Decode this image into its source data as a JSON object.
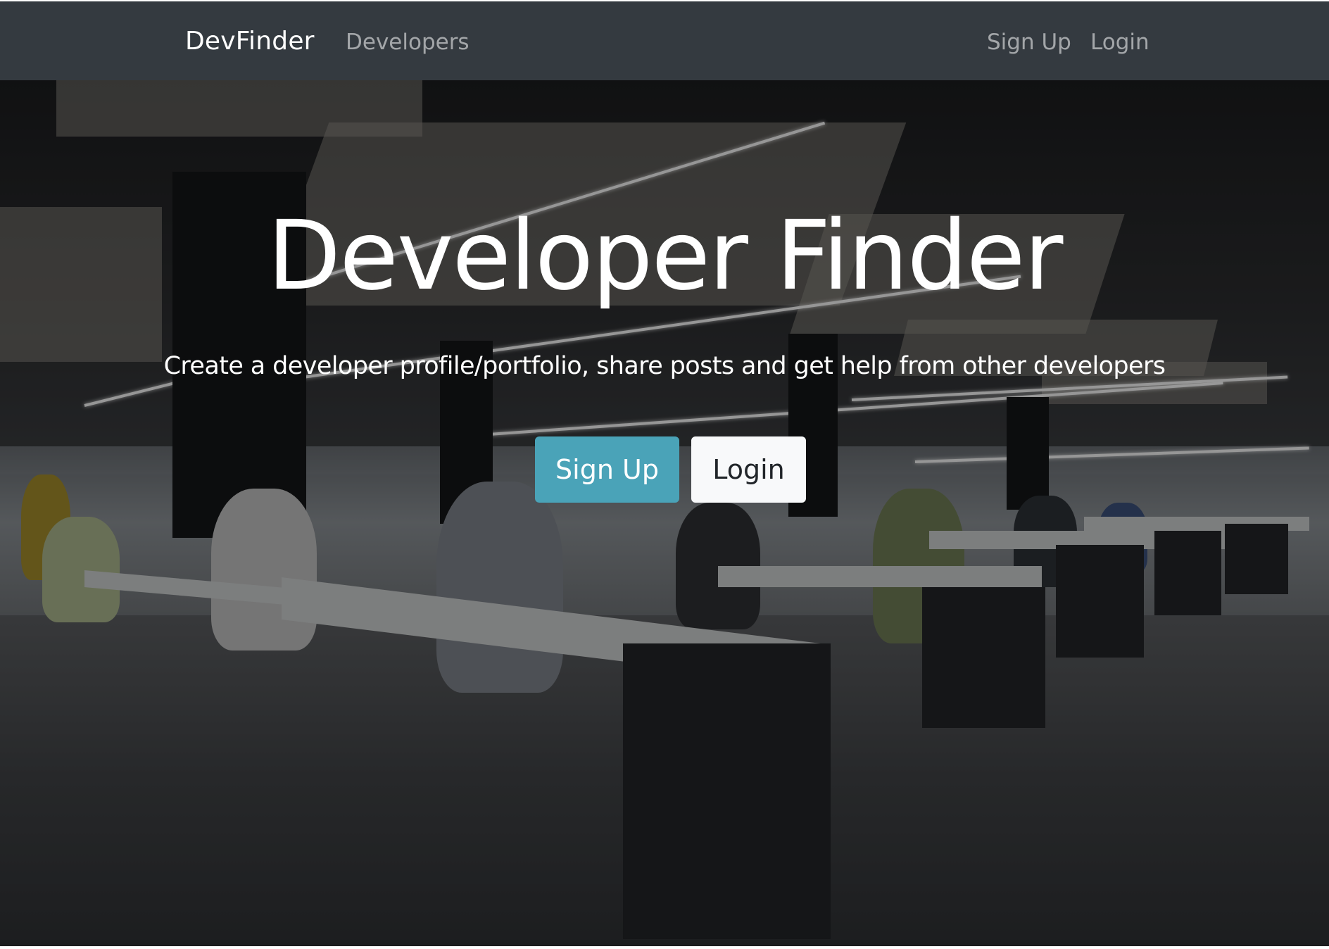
{
  "navbar": {
    "brand": "DevFinder",
    "links": {
      "developers": "Developers",
      "signup": "Sign Up",
      "login": "Login"
    }
  },
  "hero": {
    "title": "Developer Finder",
    "lead": "Create a developer profile/portfolio, share posts and get help from other developers",
    "buttons": {
      "signup": "Sign Up",
      "login": "Login"
    },
    "background_image": "open-plan-office-developers-photo"
  },
  "colors": {
    "navbar_bg": "#343a40",
    "primary_button": "#4aa3b8",
    "light_button": "#f8f9fa",
    "text_light": "#ffffff"
  }
}
